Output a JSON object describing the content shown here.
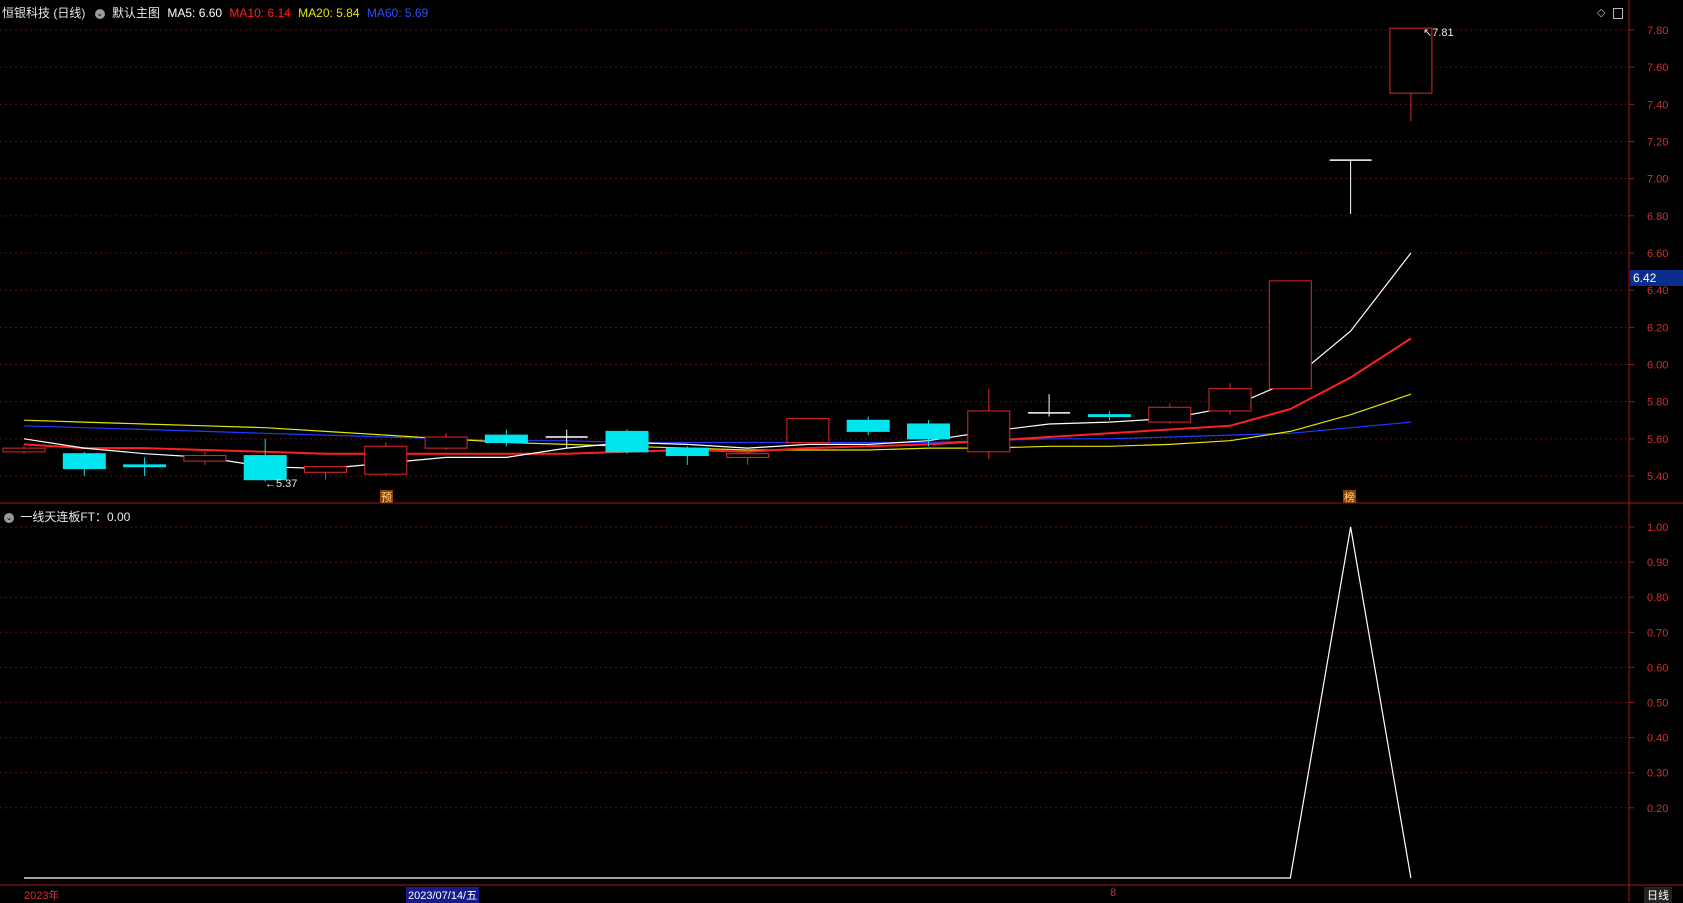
{
  "header": {
    "stock": "恒银科技 (日线)",
    "main_chart": "默认主图",
    "ma5": "MA5: 6.60",
    "ma10": "MA10: 6.14",
    "ma20": "MA20: 5.84",
    "ma60": "MA60: 5.69"
  },
  "indicator": {
    "label": "一线天连板FT：0.00"
  },
  "price_axis": {
    "ticks": [
      "7.80",
      "7.60",
      "7.40",
      "7.20",
      "7.00",
      "6.80",
      "6.60",
      "6.40",
      "6.20",
      "6.00",
      "5.80",
      "5.60",
      "5.40"
    ],
    "current_tag": "6.42"
  },
  "indicator_axis": {
    "ticks": [
      "1.00",
      "0.90",
      "0.80",
      "0.70",
      "0.60",
      "0.50",
      "0.40",
      "0.30",
      "0.20"
    ]
  },
  "annotations": {
    "high": "7.81",
    "low": "5.37",
    "marker_yu": "预",
    "marker_bang": "榜"
  },
  "x_axis": {
    "year": "2023年",
    "date_cursor": "2023/07/14/五",
    "month": "8",
    "period": "日线"
  },
  "colors": {
    "up": "#e02828",
    "down": "#00e5ee",
    "ma5": "#ffffff",
    "ma10": "#ff2020",
    "ma20": "#e6e600",
    "ma60": "#1a3cff",
    "bg": "#000000"
  },
  "chart_data": {
    "type": "candlestick",
    "price_range": [
      5.3,
      7.85
    ],
    "candles": [
      {
        "o": 5.53,
        "h": 5.56,
        "l": 5.52,
        "c": 5.55
      },
      {
        "o": 5.52,
        "h": 5.53,
        "l": 5.4,
        "c": 5.44
      },
      {
        "o": 5.46,
        "h": 5.5,
        "l": 5.4,
        "c": 5.45
      },
      {
        "o": 5.48,
        "h": 5.53,
        "l": 5.46,
        "c": 5.51
      },
      {
        "o": 5.51,
        "h": 5.6,
        "l": 5.37,
        "c": 5.38
      },
      {
        "o": 5.42,
        "h": 5.45,
        "l": 5.38,
        "c": 5.45
      },
      {
        "o": 5.41,
        "h": 5.58,
        "l": 5.4,
        "c": 5.56
      },
      {
        "o": 5.55,
        "h": 5.63,
        "l": 5.54,
        "c": 5.61
      },
      {
        "o": 5.62,
        "h": 5.65,
        "l": 5.56,
        "c": 5.58
      },
      {
        "o": 5.61,
        "h": 5.65,
        "l": 5.55,
        "c": 5.61
      },
      {
        "o": 5.64,
        "h": 5.65,
        "l": 5.52,
        "c": 5.53
      },
      {
        "o": 5.55,
        "h": 5.56,
        "l": 5.46,
        "c": 5.51
      },
      {
        "o": 5.5,
        "h": 5.53,
        "l": 5.46,
        "c": 5.52
      },
      {
        "o": 5.58,
        "h": 5.71,
        "l": 5.58,
        "c": 5.71
      },
      {
        "o": 5.7,
        "h": 5.72,
        "l": 5.62,
        "c": 5.64
      },
      {
        "o": 5.68,
        "h": 5.7,
        "l": 5.56,
        "c": 5.6
      },
      {
        "o": 5.53,
        "h": 5.87,
        "l": 5.49,
        "c": 5.75
      },
      {
        "o": 5.74,
        "h": 5.84,
        "l": 5.72,
        "c": 5.74
      },
      {
        "o": 5.73,
        "h": 5.75,
        "l": 5.7,
        "c": 5.72
      },
      {
        "o": 5.69,
        "h": 5.79,
        "l": 5.68,
        "c": 5.77
      },
      {
        "o": 5.75,
        "h": 5.9,
        "l": 5.73,
        "c": 5.87
      },
      {
        "o": 5.87,
        "h": 6.45,
        "l": 5.87,
        "c": 6.45
      },
      {
        "o": 7.1,
        "h": 7.1,
        "l": 6.81,
        "c": 7.1
      },
      {
        "o": 7.46,
        "h": 7.81,
        "l": 7.31,
        "c": 7.81
      }
    ],
    "ma5": [
      5.6,
      5.55,
      5.52,
      5.5,
      5.45,
      5.44,
      5.47,
      5.5,
      5.5,
      5.55,
      5.58,
      5.57,
      5.55,
      5.57,
      5.57,
      5.59,
      5.64,
      5.68,
      5.69,
      5.71,
      5.77,
      5.91,
      6.18,
      6.6
    ],
    "ma10": [
      5.57,
      5.55,
      5.55,
      5.54,
      5.53,
      5.52,
      5.52,
      5.52,
      5.52,
      5.52,
      5.53,
      5.54,
      5.53,
      5.55,
      5.56,
      5.57,
      5.59,
      5.61,
      5.63,
      5.65,
      5.67,
      5.76,
      5.93,
      6.14
    ],
    "ma20": [
      5.7,
      5.69,
      5.68,
      5.67,
      5.66,
      5.64,
      5.62,
      5.6,
      5.58,
      5.57,
      5.56,
      5.55,
      5.54,
      5.54,
      5.54,
      5.55,
      5.55,
      5.56,
      5.56,
      5.57,
      5.59,
      5.64,
      5.73,
      5.84
    ],
    "ma60": [
      5.67,
      5.66,
      5.65,
      5.64,
      5.63,
      5.62,
      5.61,
      5.6,
      5.59,
      5.59,
      5.58,
      5.58,
      5.58,
      5.58,
      5.58,
      5.58,
      5.59,
      5.6,
      5.6,
      5.61,
      5.62,
      5.63,
      5.66,
      5.69
    ],
    "indicator": [
      0,
      0,
      0,
      0,
      0,
      0,
      0,
      0,
      0,
      0,
      0,
      0,
      0,
      0,
      0,
      0,
      0,
      0,
      0,
      0,
      0,
      0,
      1,
      0
    ]
  }
}
